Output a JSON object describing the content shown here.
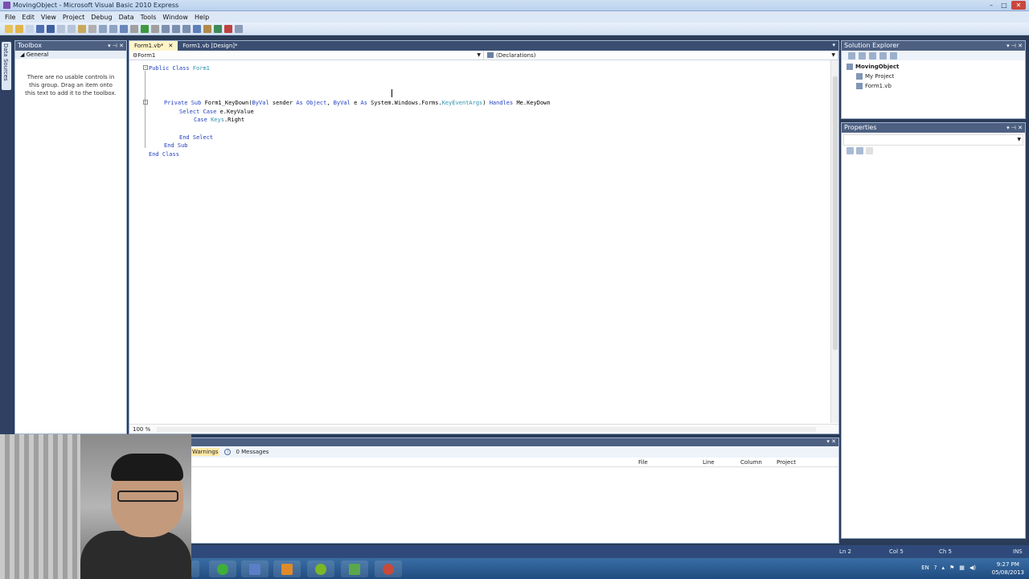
{
  "window": {
    "title": "MovingObject - Microsoft Visual Basic 2010 Express"
  },
  "menu": [
    "File",
    "Edit",
    "View",
    "Project",
    "Debug",
    "Data",
    "Tools",
    "Window",
    "Help"
  ],
  "side_tab": "Data Sources",
  "toolbox": {
    "title": "Toolbox",
    "group": "General",
    "message": "There are no usable controls in this group. Drag an item onto this text to add it to the toolbox."
  },
  "editor": {
    "tabs": [
      {
        "label": "Form1.vb*",
        "active": true
      },
      {
        "label": "Form1.vb [Design]*",
        "active": false
      }
    ],
    "nav_left": "Form1",
    "nav_right": "(Declarations)",
    "zoom": "100 %",
    "lines": [
      [
        "Public Class",
        "Form1"
      ],
      [
        "Private Sub",
        "Form1_KeyDown(",
        "ByVal",
        "sender",
        "As Object",
        ",",
        "ByVal",
        "e",
        "As",
        "System.Windows.Forms.",
        "KeyEventArgs",
        ")",
        "Handles",
        "Me.KeyDown"
      ],
      [
        "Select Case",
        "e.KeyValue"
      ],
      [
        "Case",
        "Keys",
        ".Right"
      ],
      [
        "End Select"
      ],
      [
        "End Sub"
      ],
      [
        "End Class"
      ]
    ]
  },
  "solution_explorer": {
    "title": "Solution Explorer",
    "project": "MovingObject",
    "items": [
      "My Project",
      "Form1.vb"
    ]
  },
  "properties": {
    "title": "Properties"
  },
  "error_list": {
    "warnings": "Warnings",
    "messages": "0 Messages",
    "columns": [
      "File",
      "Line",
      "Column",
      "Project"
    ]
  },
  "status": {
    "line": "Ln 2",
    "col": "Col 5",
    "ch": "Ch 5",
    "mode": "INS"
  },
  "tray": {
    "lang": "EN",
    "time": "9:27 PM",
    "date": "05/08/2013"
  },
  "colors": {
    "keyword": "#1f3fbf",
    "type": "#2b91af",
    "chrome": "#2b3c59",
    "active_tab": "#fff5c9"
  }
}
